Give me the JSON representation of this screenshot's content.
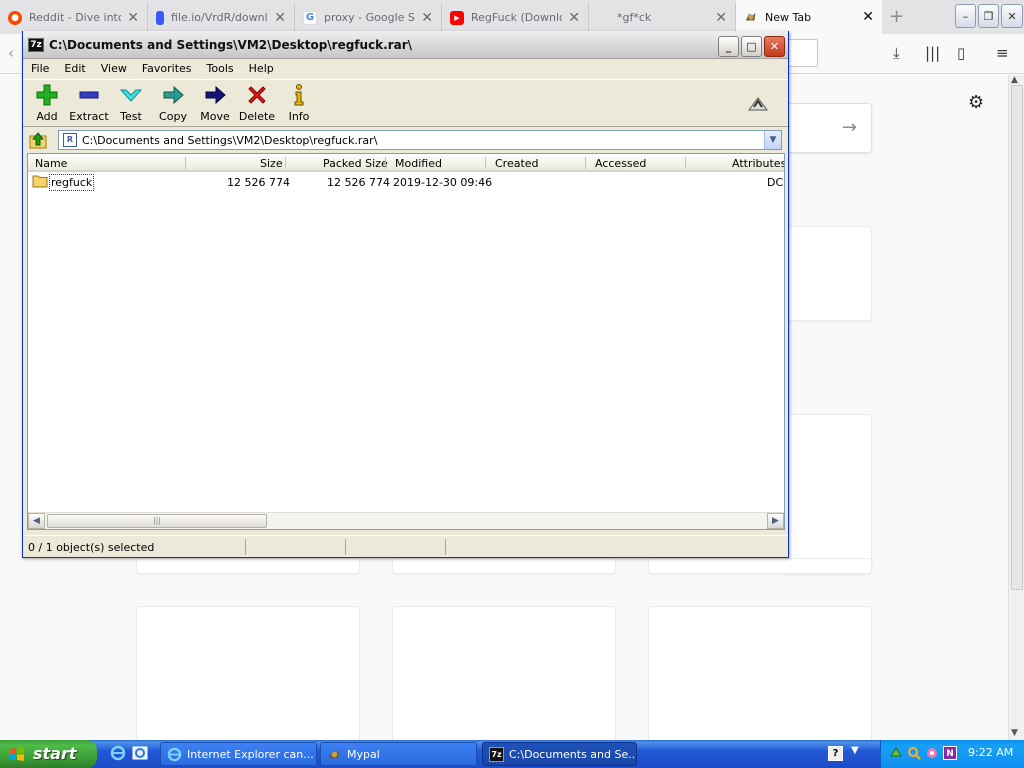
{
  "browser": {
    "tabs": [
      {
        "label": "Reddit - Dive into",
        "icon": "reddit-icon",
        "color": "#ff4500"
      },
      {
        "label": "file.io/VrdR/downl",
        "icon": "fileio-icon",
        "color": "#3d5afe"
      },
      {
        "label": "proxy - Google Se",
        "icon": "google-icon",
        "color": "#4285f4"
      },
      {
        "label": "RegFuck (Downlo",
        "icon": "youtube-icon",
        "color": "#ff0000"
      },
      {
        "label": "*gf*ck",
        "icon": "",
        "color": ""
      },
      {
        "label": "New Tab",
        "icon": "firefox-icon",
        "color": ""
      }
    ],
    "new_tab_glyph": "+"
  },
  "sevenzip": {
    "title": "C:\\Documents and Settings\\VM2\\Desktop\\regfuck.rar\\",
    "app_icon_text": "7z",
    "menu": [
      "File",
      "Edit",
      "View",
      "Favorites",
      "Tools",
      "Help"
    ],
    "toolbar": [
      {
        "label": "Add",
        "icon": "add-icon"
      },
      {
        "label": "Extract",
        "icon": "extract-icon"
      },
      {
        "label": "Test",
        "icon": "test-icon"
      },
      {
        "label": "Copy",
        "icon": "copy-icon"
      },
      {
        "label": "Move",
        "icon": "move-icon"
      },
      {
        "label": "Delete",
        "icon": "delete-icon"
      },
      {
        "label": "Info",
        "icon": "info-icon"
      }
    ],
    "address": "C:\\Documents and Settings\\VM2\\Desktop\\regfuck.rar\\",
    "columns": [
      "Name",
      "Size",
      "Packed Size",
      "Modified",
      "Created",
      "Accessed",
      "Attributes"
    ],
    "rows": [
      {
        "name": "regfuck",
        "size": "12 526 774",
        "packed": "12 526 774",
        "modified": "2019-12-30 09:46",
        "created": "",
        "accessed": "",
        "attributes": "DC"
      }
    ],
    "status": "0 / 1 object(s) selected"
  },
  "taskbar": {
    "start_label": "start",
    "items": [
      {
        "label": "Internet Explorer can...",
        "icon": "ie-icon"
      },
      {
        "label": "Mypal",
        "icon": "mypal-icon"
      },
      {
        "label": "C:\\Documents and Se...",
        "icon": "sevenzip-icon"
      }
    ],
    "clock": "9:22 AM",
    "help_glyph": "?",
    "tray_badge": "N"
  }
}
